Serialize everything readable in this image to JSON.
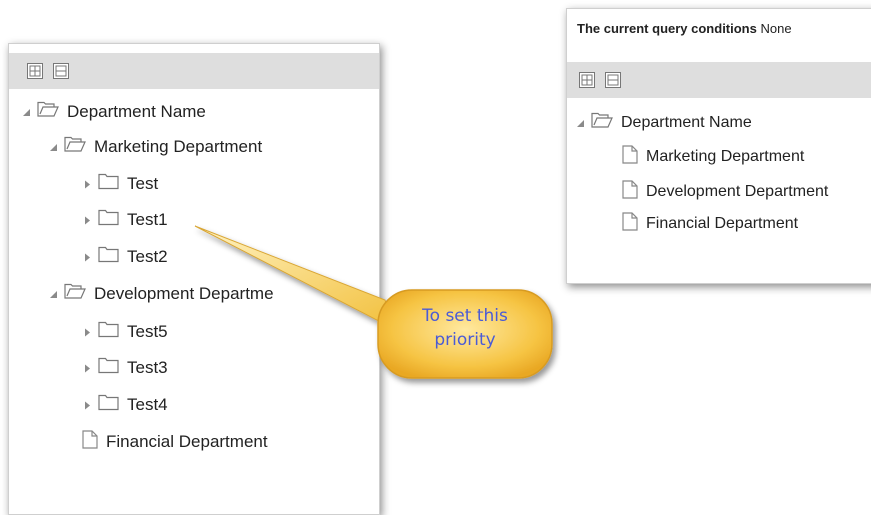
{
  "left_panel": {
    "tree": [
      {
        "label": "Department Name",
        "type": "folder-open",
        "arrow": "expanded"
      },
      {
        "label": "Marketing Department",
        "type": "folder-open",
        "arrow": "expanded"
      },
      {
        "label": "Test",
        "type": "folder",
        "arrow": "collapsed"
      },
      {
        "label": "Test1",
        "type": "folder",
        "arrow": "collapsed"
      },
      {
        "label": "Test2",
        "type": "folder",
        "arrow": "collapsed"
      },
      {
        "label": "Development Departme",
        "type": "folder-open",
        "arrow": "expanded"
      },
      {
        "label": "Test5",
        "type": "folder",
        "arrow": "collapsed"
      },
      {
        "label": "Test3",
        "type": "folder",
        "arrow": "collapsed"
      },
      {
        "label": "Test4",
        "type": "folder",
        "arrow": "collapsed"
      },
      {
        "label": "Financial Department",
        "type": "file",
        "arrow": "none"
      }
    ]
  },
  "right_panel": {
    "conditions_label": "The current query conditions",
    "conditions_value": "None",
    "tree": [
      {
        "label": "Department Name",
        "type": "folder-open",
        "arrow": "expanded"
      },
      {
        "label": "Marketing Department",
        "type": "file",
        "arrow": "none"
      },
      {
        "label": "Development Department",
        "type": "file",
        "arrow": "none"
      },
      {
        "label": "Financial Department",
        "type": "file",
        "arrow": "none"
      }
    ]
  },
  "callout": {
    "line1": "To set this",
    "line2": "priority",
    "fill_color": "#f5c542"
  }
}
